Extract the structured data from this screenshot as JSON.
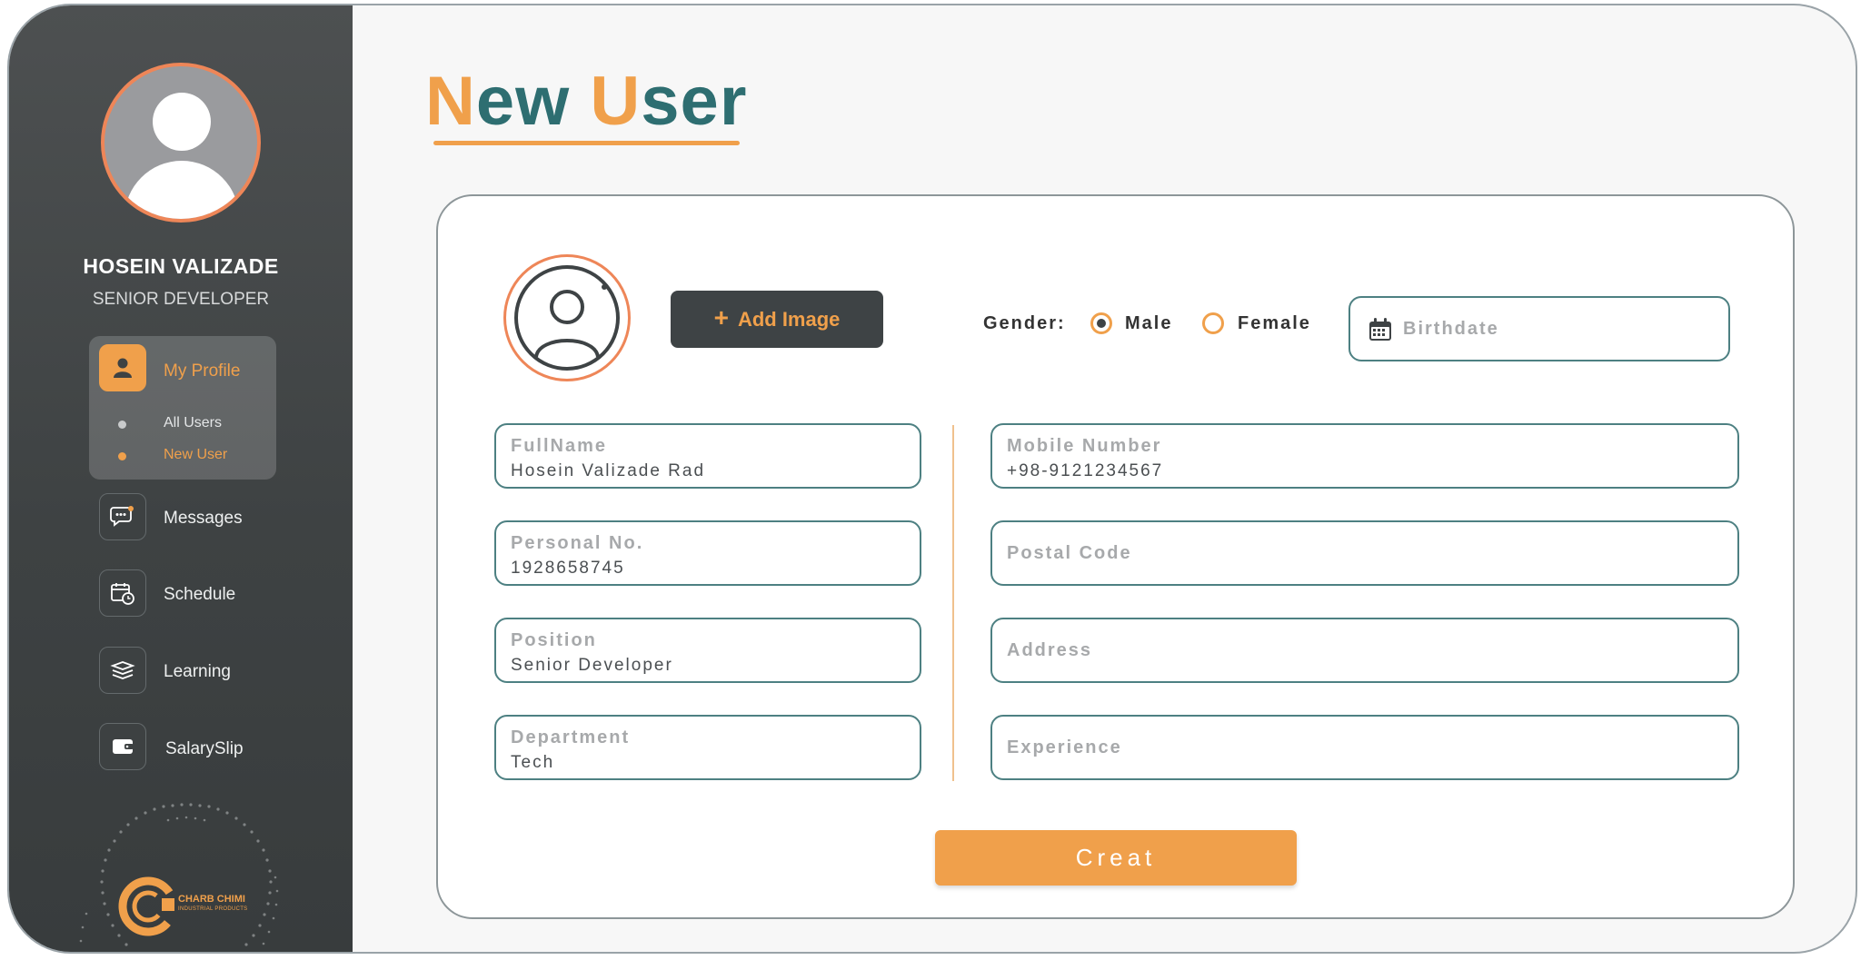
{
  "sidebar": {
    "user_name": "HOSEIN VALIZADE",
    "user_role": "SENIOR DEVELOPER",
    "menu": {
      "my_profile": "My Profile",
      "all_users": "All Users",
      "new_user": "New User",
      "messages": "Messages",
      "schedule": "Schedule",
      "learning": "Learning",
      "salary_slip": "SalarySlip"
    },
    "logo": {
      "name": "CHARB CHIMI",
      "tagline": "INDUSTRIAL PRODUCTS"
    }
  },
  "page": {
    "title_part1_initial": "N",
    "title_part1_rest": "ew ",
    "title_part2_initial": "U",
    "title_part2_rest": "ser"
  },
  "form": {
    "add_image_label": "Add Image",
    "gender_label": "Gender:",
    "gender_options": [
      "Male",
      "Female"
    ],
    "gender_selected": "Male",
    "birthdate_placeholder": "Birthdate",
    "fields": {
      "fullname": {
        "label": "FullName",
        "value": "Hosein Valizade Rad"
      },
      "personal_no": {
        "label": "Personal No.",
        "value": "1928658745"
      },
      "position": {
        "label": "Position",
        "value": "Senior Developer"
      },
      "department": {
        "label": "Department",
        "value": "Tech"
      },
      "mobile": {
        "label": "Mobile Number",
        "value": "+98-9121234567"
      },
      "postal_code": {
        "placeholder": "Postal Code"
      },
      "address": {
        "placeholder": "Address"
      },
      "experience": {
        "placeholder": "Experience"
      }
    },
    "submit_label": "Creat"
  },
  "colors": {
    "accent_orange": "#f0a04b",
    "teal": "#2e6e71",
    "sidebar_dark": "#3e4243",
    "avatar_ring": "#ee8658"
  }
}
